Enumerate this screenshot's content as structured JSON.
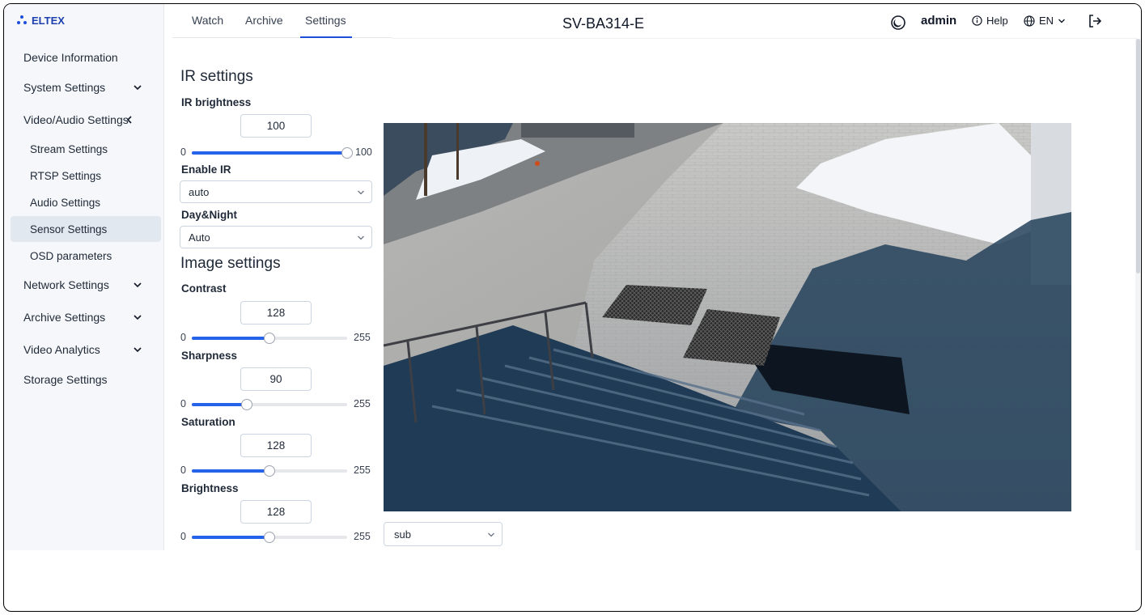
{
  "brand": {
    "name": "ELTEX"
  },
  "sidebar": {
    "items": [
      {
        "label": "Device Information"
      },
      {
        "label": "System Settings"
      },
      {
        "label": "Video/Audio Settings"
      },
      {
        "label": "Stream Settings"
      },
      {
        "label": "RTSP Settings"
      },
      {
        "label": "Audio Settings"
      },
      {
        "label": "Sensor Settings"
      },
      {
        "label": "OSD parameters"
      },
      {
        "label": "Network Settings"
      },
      {
        "label": "Archive Settings"
      },
      {
        "label": "Video Analytics"
      },
      {
        "label": "Storage Settings"
      }
    ],
    "active": "Sensor Settings"
  },
  "header": {
    "tabs": [
      {
        "label": "Watch"
      },
      {
        "label": "Archive"
      },
      {
        "label": "Settings"
      }
    ],
    "active_tab": "Settings",
    "device_title": "SV-BA314-E",
    "user": "admin",
    "help_label": "Help",
    "language": "EN",
    "icons": [
      "theme-toggle-icon",
      "help-icon",
      "globe-icon",
      "logout-icon"
    ]
  },
  "ir": {
    "title": "IR settings",
    "brightness": {
      "label": "IR brightness",
      "value": "100",
      "min": "0",
      "max": "100"
    },
    "enable_ir": {
      "label": "Enable IR",
      "value": "auto"
    },
    "day_night": {
      "label": "Day&Night",
      "value": "Auto"
    }
  },
  "image": {
    "title": "Image settings",
    "contrast": {
      "label": "Contrast",
      "value": "128",
      "min": "0",
      "max": "255"
    },
    "sharpness": {
      "label": "Sharpness",
      "value": "90",
      "min": "0",
      "max": "255"
    },
    "saturation": {
      "label": "Saturation",
      "value": "128",
      "min": "0",
      "max": "255"
    },
    "brightness": {
      "label": "Brightness",
      "value": "128",
      "min": "0",
      "max": "255"
    }
  },
  "video": {
    "stream": "sub"
  },
  "colors": {
    "accent": "#2563eb",
    "sidebar_bg": "#f5f7fa",
    "active_item": "#e2e8f0"
  }
}
